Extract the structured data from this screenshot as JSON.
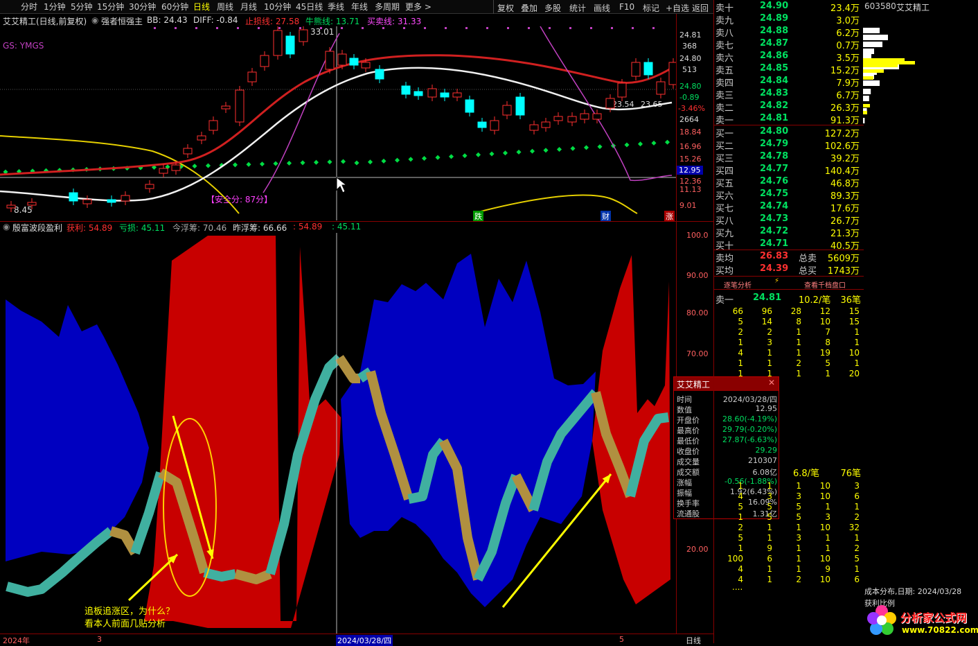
{
  "toolbar": {
    "periods": [
      "分时",
      "1分钟",
      "5分钟",
      "15分钟",
      "30分钟",
      "60分钟",
      "日线",
      "周线",
      "月线",
      "10分钟",
      "45日线",
      "季线",
      "年线",
      "多周期",
      "更多 >"
    ],
    "right": [
      "复权",
      "叠加",
      "多股",
      "统计",
      "画线",
      "F10",
      "标记",
      "+自选",
      "返回"
    ]
  },
  "main_indicator": {
    "title": "艾艾精工(日线,前复权)",
    "formula": "强者恒强主",
    "bb": "BB: 24.43",
    "diff": "DIFF: -0.84",
    "stop": "止损线: 27.58",
    "bull": "牛熊线: 13.71",
    "trade": "买卖线: 31.33",
    "gs": "GS: YMGS",
    "high_label": "33.01",
    "low_label": "8.45",
    "mid1": "23.54",
    "mid2": "23.65",
    "safety": "【安全分: 87分】",
    "badges": [
      "跌",
      "财",
      "涨"
    ]
  },
  "price_axis": {
    "labels": [
      "24.81",
      "368",
      "24.80",
      "513",
      "24.80",
      "-0.89",
      "-3.46%",
      "2664",
      "18.84",
      "16.96",
      "15.26",
      "12.95",
      "12.36",
      "11.13",
      "9.01"
    ]
  },
  "sub_indicator": {
    "title": "殷富波段盈利",
    "win": "获利: 54.89",
    "loss": "亏损: 45.11",
    "today": "今浮筹: 70.46",
    "yest": "昨浮筹: 66.66",
    "v1": ": 54.89",
    "v2": ": 45.11",
    "annotation": [
      "追板追涨区，为什么？",
      "看本人前面几贴分析"
    ]
  },
  "sub_axis": {
    "labels": [
      "100.0",
      "90.00",
      "80.00",
      "70.00",
      "20.00"
    ]
  },
  "date_axis": {
    "labels": [
      "2024年",
      "3",
      "2024/03/28/四",
      "5",
      "日线"
    ]
  },
  "orderbook": {
    "asks": [
      {
        "label": "卖十",
        "price": "24.90",
        "vol": "23.4万"
      },
      {
        "label": "卖九",
        "price": "24.89",
        "vol": "3.0万"
      },
      {
        "label": "卖八",
        "price": "24.88",
        "vol": "6.2万"
      },
      {
        "label": "卖七",
        "price": "24.87",
        "vol": "0.7万"
      },
      {
        "label": "卖六",
        "price": "24.86",
        "vol": "3.5万"
      },
      {
        "label": "卖五",
        "price": "24.85",
        "vol": "15.2万"
      },
      {
        "label": "卖四",
        "price": "24.84",
        "vol": "7.9万"
      },
      {
        "label": "卖三",
        "price": "24.83",
        "vol": "6.7万"
      },
      {
        "label": "卖二",
        "price": "24.82",
        "vol": "26.3万"
      },
      {
        "label": "卖一",
        "price": "24.81",
        "vol": "91.3万"
      }
    ],
    "bids": [
      {
        "label": "买一",
        "price": "24.80",
        "vol": "127.2万"
      },
      {
        "label": "买二",
        "price": "24.79",
        "vol": "102.6万"
      },
      {
        "label": "买三",
        "price": "24.78",
        "vol": "39.2万"
      },
      {
        "label": "买四",
        "price": "24.77",
        "vol": "140.4万"
      },
      {
        "label": "买五",
        "price": "24.76",
        "vol": "46.8万"
      },
      {
        "label": "买六",
        "price": "24.75",
        "vol": "89.3万"
      },
      {
        "label": "买七",
        "price": "24.74",
        "vol": "17.6万"
      },
      {
        "label": "买八",
        "price": "24.73",
        "vol": "26.7万"
      },
      {
        "label": "买九",
        "price": "24.72",
        "vol": "21.3万"
      },
      {
        "label": "买十",
        "price": "24.71",
        "vol": "40.5万"
      }
    ],
    "summary": [
      {
        "label": "卖均",
        "price": "26.83",
        "label2": "总卖",
        "vol": "5609万"
      },
      {
        "label": "买均",
        "price": "24.39",
        "label2": "总买",
        "vol": "1743万"
      }
    ],
    "tabs": [
      "逐笔分析",
      "查看千档盘口"
    ],
    "ticker_sell": {
      "label": "卖一",
      "price": "24.81",
      "per": "10.2/笔",
      "count": "36笔"
    },
    "ticker_buy": {
      "per": "6.8/笔",
      "count": "76笔"
    },
    "sell_grid": [
      [
        "66",
        "96",
        "28",
        "12",
        "15"
      ],
      [
        "5",
        "14",
        "8",
        "10",
        "15"
      ],
      [
        "2",
        "2",
        "1",
        "7",
        "1"
      ],
      [
        "1",
        "3",
        "1",
        "8",
        "1"
      ],
      [
        "4",
        "1",
        "1",
        "19",
        "10"
      ],
      [
        "1",
        "1",
        "2",
        "5",
        "1"
      ],
      [
        "1",
        "1",
        "1",
        "1",
        "20"
      ]
    ],
    "buy_grid": [
      [
        "1",
        "1",
        "1",
        "10",
        "3"
      ],
      [
        "4",
        "3",
        "3",
        "10",
        "6"
      ],
      [
        "5",
        "5",
        "5",
        "1",
        "1"
      ],
      [
        "1",
        "5",
        "5",
        "3",
        "2"
      ],
      [
        "2",
        "1",
        "1",
        "10",
        "32"
      ],
      [
        "5",
        "1",
        "3",
        "1",
        "1"
      ],
      [
        "1",
        "9",
        "1",
        "1",
        "2"
      ],
      [
        "100",
        "6",
        "1",
        "10",
        "5"
      ],
      [
        "4",
        "1",
        "1",
        "9",
        "1"
      ],
      [
        "4",
        "1",
        "2",
        "10",
        "6"
      ]
    ],
    "more": "...."
  },
  "stock": {
    "code": "603580",
    "name": "艾艾精工",
    "cost_dist": "成本分布,日期: 2024/03/28",
    "profit_ratio": "获利比例",
    "watermark": "分析家公式网",
    "watermark_url": "www.70822.com"
  },
  "popup": {
    "title": "艾艾精工",
    "rows": [
      {
        "k": "时间",
        "v": "2024/03/28/四",
        "c": "#ccc"
      },
      {
        "k": "数值",
        "v": "12.95",
        "c": "#ccc"
      },
      {
        "k": "开盘价",
        "v": "28.60(-4.19%)",
        "c": "#00e060"
      },
      {
        "k": "最高价",
        "v": "29.79(-0.20%)",
        "c": "#00e060"
      },
      {
        "k": "最低价",
        "v": "27.87(-6.63%)",
        "c": "#00e060"
      },
      {
        "k": "收盘价",
        "v": "29.29",
        "c": "#00e060"
      },
      {
        "k": "成交量",
        "v": "210307",
        "c": "#ccc"
      },
      {
        "k": "成交额",
        "v": "6.08亿",
        "c": "#ccc"
      },
      {
        "k": "涨幅",
        "v": "-0.56(-1.88%)",
        "c": "#00e060"
      },
      {
        "k": "振幅",
        "v": "1.92(6.43%)",
        "c": "#ccc"
      },
      {
        "k": "换手率",
        "v": "16.09%",
        "c": "#ccc"
      },
      {
        "k": "流通股",
        "v": "1.31亿",
        "c": "#ccc"
      }
    ]
  },
  "colors": {
    "up": "#ff3030",
    "down": "#00ffff",
    "fall": "#00e060",
    "yellow": "#ffff00",
    "red_area": "#c80000",
    "blue_area": "#0000c0"
  }
}
